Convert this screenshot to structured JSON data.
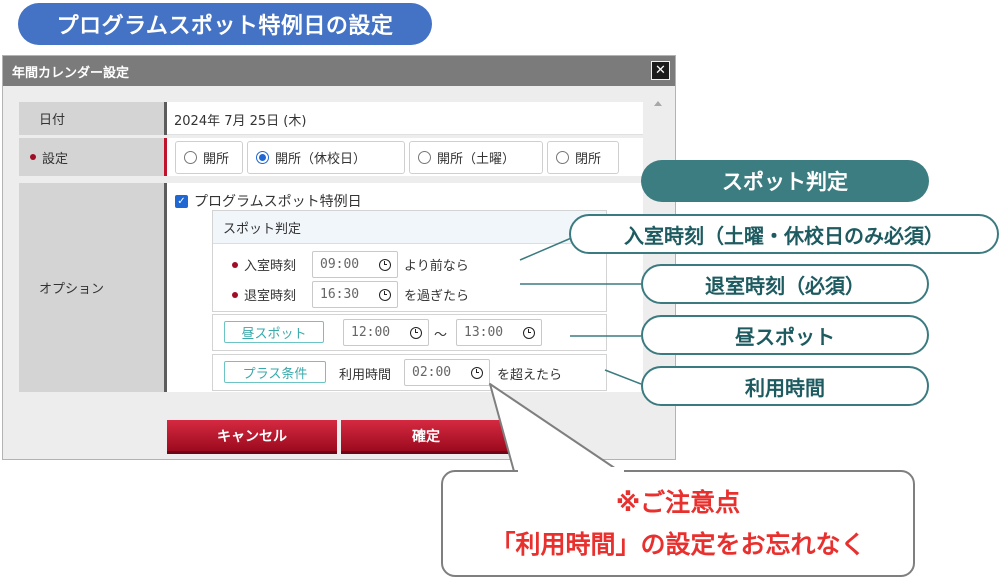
{
  "headline": "プログラムスポット特例日の設定",
  "dialog": {
    "title": "年間カレンダー設定",
    "close_label": "x",
    "date_row": {
      "label": "日付",
      "value": "2024年 7月 25日 (木)"
    },
    "setting_row": {
      "label": "設定",
      "options": [
        {
          "label": "開所",
          "selected": false
        },
        {
          "label": "開所（休校日）",
          "selected": true
        },
        {
          "label": "開所（土曜）",
          "selected": false
        },
        {
          "label": "閉所",
          "selected": false
        }
      ]
    },
    "option_row": {
      "label": "オプション",
      "checkbox_label": "プログラムスポット特例日",
      "checked": true,
      "spot_title": "スポット判定",
      "entry": {
        "label": "入室時刻",
        "value": "09:00",
        "suffix": "より前なら"
      },
      "exit": {
        "label": "退室時刻",
        "value": "16:30",
        "suffix": "を過ぎたら"
      },
      "lunch": {
        "button": "昼スポット",
        "from": "12:00",
        "sep": "〜",
        "to": "13:00"
      },
      "plus": {
        "button": "プラス条件",
        "label": "利用時間",
        "value": "02:00",
        "suffix": "を超えたら"
      }
    },
    "cancel_label": "キャンセル",
    "confirm_label": "確定"
  },
  "callouts": {
    "header": "スポット判定",
    "entry": "入室時刻（土曜・休校日のみ必須）",
    "exit": "退室時刻（必須）",
    "lunch": "昼スポット",
    "usage": "利用時間"
  },
  "note": {
    "line1": "※ご注意点",
    "line2": "「利用時間」の設定をお忘れなく"
  },
  "colors": {
    "headline": "#4472c4",
    "callout": "#3b7d80",
    "note_text": "#e8312e",
    "button": "#c2162e",
    "required_dot": "#a10d24"
  }
}
